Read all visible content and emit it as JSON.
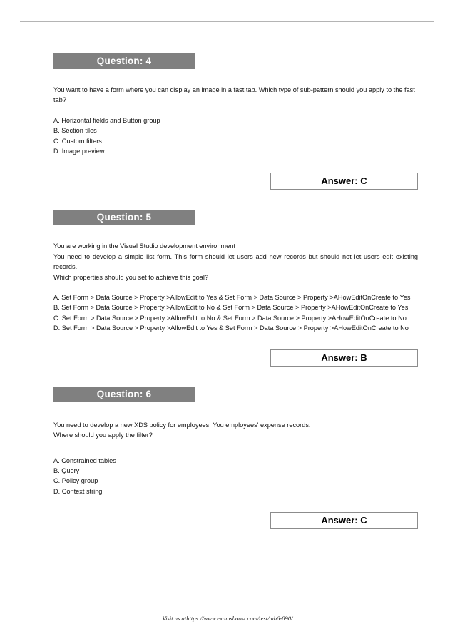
{
  "page": {
    "footer_text": "Visit us athttps://www.examsboost.com/test/mb6-890/",
    "header_bar_color": "#808080",
    "header_text_color": "#ffffff",
    "answer_box_border_color": "#8c8c8c"
  },
  "questions": [
    {
      "header": "Question: 4",
      "body": "You want to have a form where you can display an image in a fast tab. Which type of sub-pattern should you apply to the fast tab?",
      "options": [
        "A. Horizontal fields and Button group",
        "B. Section tiles",
        "C. Custom filters",
        "D. Image preview"
      ],
      "answer": "Answer: C"
    },
    {
      "header": "Question: 5",
      "body": "You are working in the Visual Studio development environment\nYou need to develop a simple list form. This form should let users add new records but should not let users edit existing records.\nWhich properties should you set to achieve this goal?",
      "options": [
        "A. Set Form > Data Source > Property >AllowEdit to Yes & Set Form > Data Source > Property >AHowEditOnCreate to Yes",
        "B. Set Form > Data Source > Property >AllowEdit to No & Set Form > Data Source > Property >AHowEditOnCreate to Yes",
        "C. Set Form > Data Source > Property >AllowEdit to No & Set Form > Data Source > Property >AHowEditOnCreate to No",
        "D. Set Form > Data Source > Property >AllowEdit to Yes & Set Form > Data Source > Property >AHowEditOnCreate to No"
      ],
      "answer": "Answer: B"
    },
    {
      "header": "Question: 6",
      "body": "You need to develop a new XDS policy for employees. You employees' expense records.\nWhere should you apply the filter?",
      "options": [
        "A. Constrained tables",
        "B. Query",
        "C. Policy group",
        "D. Context string"
      ],
      "answer": "Answer: C"
    }
  ]
}
